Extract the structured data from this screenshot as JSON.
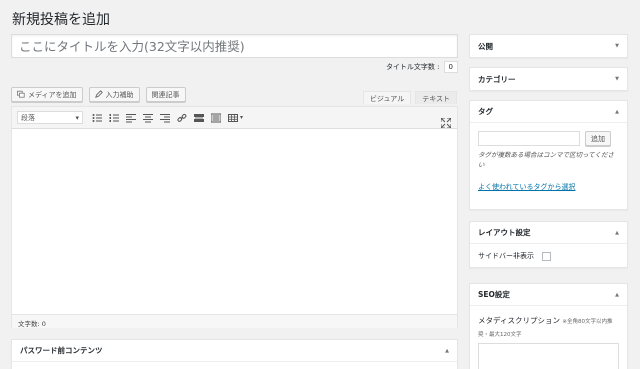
{
  "page": {
    "title": "新規投稿を追加"
  },
  "post_title": {
    "placeholder": "ここにタイトルを入力(32文字以内推奨)"
  },
  "title_counter": {
    "label": "タイトル文字数 :",
    "value": "0"
  },
  "media_buttons": {
    "add_media": "メディアを追加",
    "input_assist": "入力補助",
    "related_post": "関連記事"
  },
  "editor_tabs": {
    "visual": "ビジュアル",
    "text": "テキスト"
  },
  "toolbar": {
    "format_select": "段落",
    "icons": [
      "bullet-list-icon",
      "numbered-list-icon",
      "align-left-icon",
      "align-center-icon",
      "align-right-icon",
      "link-icon",
      "more-tag-icon",
      "toolbar-toggle-icon",
      "table-icon",
      "fullscreen-icon"
    ]
  },
  "status_bar": {
    "word_count": "文字数: 0"
  },
  "password_box": {
    "title": "パスワード前コンテンツ"
  },
  "sidebar": {
    "publish": {
      "title": "公開"
    },
    "category": {
      "title": "カテゴリー"
    },
    "tags": {
      "title": "タグ",
      "add_button": "追加",
      "hint": "タグが複数ある場合はコンマで区切ってください",
      "choose_link": "よく使われているタグから選択"
    },
    "layout": {
      "title": "レイアウト設定",
      "sidebar_hide_label": "サイドバー非表示"
    },
    "seo": {
      "title": "SEO設定",
      "meta_label": "メタディスクリプション",
      "meta_hint": "※全角80文字以内推奨・最大120文字"
    }
  },
  "colors": {
    "accent": "#0073aa",
    "background": "#f1f1f1"
  }
}
